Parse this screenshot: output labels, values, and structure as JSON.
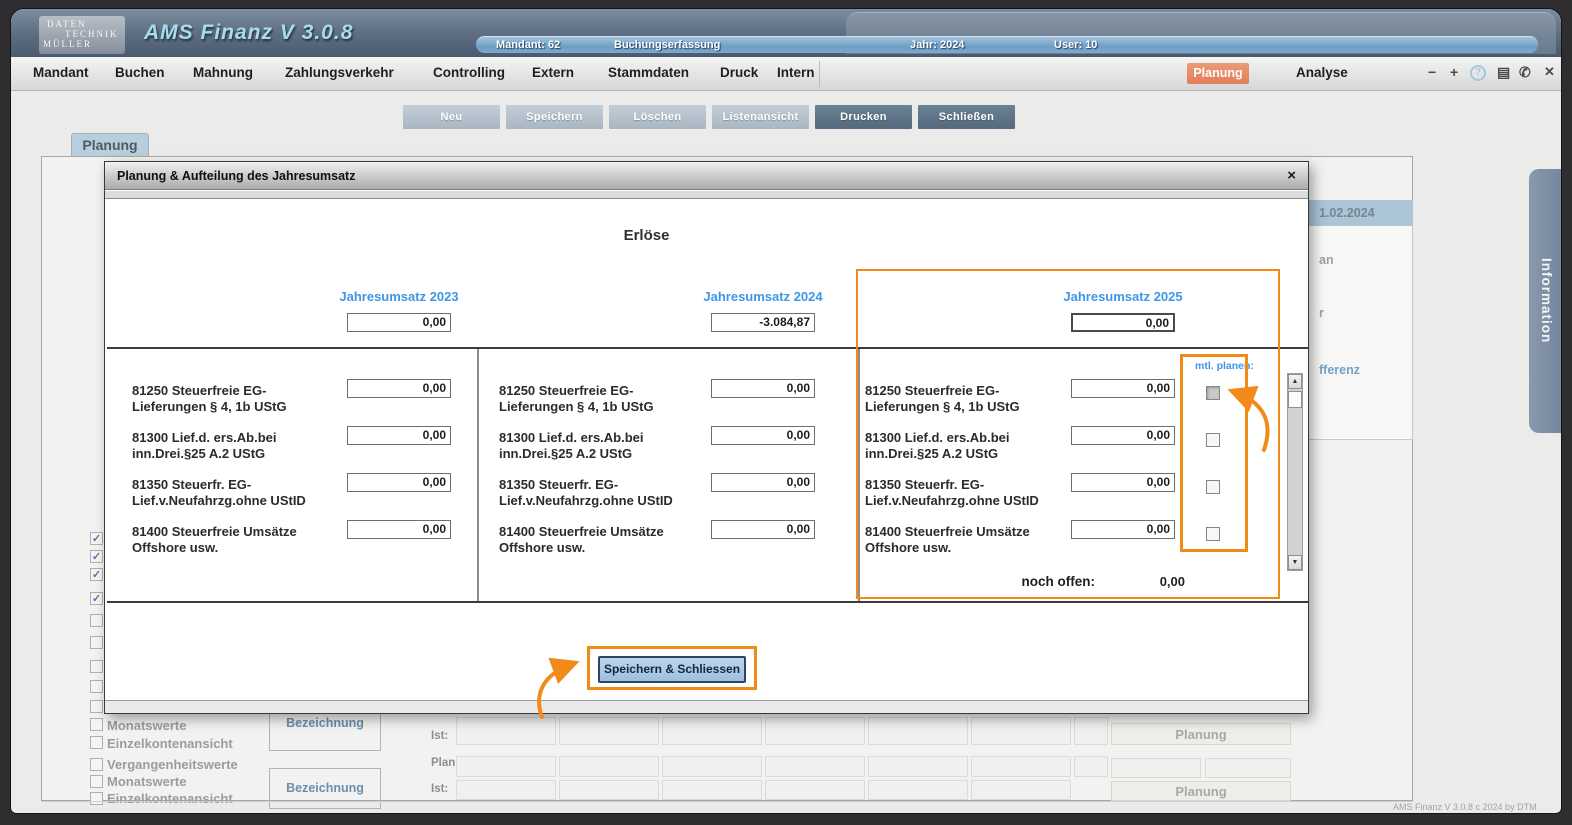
{
  "colors": {
    "accent_blue": "#3D96E8",
    "annotation_orange": "#F28A1A",
    "active_tab_salmon": "#E8876A",
    "titlebar_slate": "#5C6D81",
    "status_strip_blue": "#7FA8CC",
    "toolbar_button_light": "#B5C2CD",
    "toolbar_button_dark": "#5D7387",
    "save_button_blue": "#A9C8E6",
    "info_tab_slate": "#7D8FA5"
  },
  "titlebar": {
    "logo_lines": [
      "DATEN",
      "TECHNIK",
      "MÜLLER"
    ],
    "app_title": "AMS Finanz V 3.0.8",
    "status_items": [
      {
        "label": "Mandant: 62"
      },
      {
        "label": "Buchungserfassung"
      },
      {
        "label": "Jahr: 2024"
      },
      {
        "label": "User: 10"
      }
    ]
  },
  "menubar": {
    "items": [
      "Mandant",
      "Buchen",
      "Mahnung",
      "Zahlungsverkehr",
      "Controlling",
      "Extern",
      "Stammdaten",
      "Druck",
      "Intern"
    ],
    "right_tabs": [
      {
        "label": "Planung",
        "active": true
      },
      {
        "label": "Analyse",
        "active": false
      }
    ],
    "window_icons": [
      {
        "name": "minus",
        "glyph": "−"
      },
      {
        "name": "plus",
        "glyph": "+"
      },
      {
        "name": "help",
        "glyph": "?"
      },
      {
        "name": "notes",
        "glyph": "▤"
      },
      {
        "name": "phone",
        "glyph": "✆"
      },
      {
        "name": "close",
        "glyph": "✕"
      }
    ]
  },
  "toolbar": {
    "buttons": [
      {
        "label": "Neu",
        "variant": "light"
      },
      {
        "label": "Speichern",
        "variant": "light"
      },
      {
        "label": "Löschen",
        "variant": "light"
      },
      {
        "label": "Listenansicht",
        "variant": "light"
      },
      {
        "label": "Drucken",
        "variant": "dark"
      },
      {
        "label": "Schließen",
        "variant": "dark"
      }
    ]
  },
  "page_tab": {
    "label": "Planung"
  },
  "modal": {
    "title": "Planung & Aufteilung des Jahresumsatz",
    "close_glyph": "×",
    "heading": "Erlöse",
    "columns": [
      {
        "header": "Jahresumsatz 2023",
        "total": "0,00",
        "row_values": [
          "0,00",
          "0,00",
          "0,00",
          "0,00"
        ]
      },
      {
        "header": "Jahresumsatz 2024",
        "total": "-3.084,87",
        "row_values": [
          "0,00",
          "0,00",
          "0,00",
          "0,00"
        ]
      },
      {
        "header": "Jahresumsatz 2025",
        "total": "0,00",
        "row_values": [
          "0,00",
          "0,00",
          "0,00",
          "0,00"
        ]
      }
    ],
    "rows": [
      {
        "line1": "81250  Steuerfreie EG-",
        "line2": "Lieferungen § 4, 1b UStG"
      },
      {
        "line1": "81300  Lief.d. ers.Ab.bei",
        "line2": "inn.Drei.§25 A.2 UStG"
      },
      {
        "line1": "81350  Steuerfr. EG-",
        "line2": "Lief.v.Neufahrzg.ohne UStID"
      },
      {
        "line1": "81400  Steuerfreie Umsätze",
        "line2": "Offshore usw."
      }
    ],
    "mtl_planen_label": "mtl. planen:",
    "checkbox_states": [
      false,
      false,
      false,
      false
    ],
    "noch_offen": {
      "label": "noch offen:",
      "value": "0,00"
    },
    "save_button_label": "Speichern & Schliessen",
    "scrollbar": {
      "up": "▲",
      "down": "▼"
    }
  },
  "background": {
    "right_panel": {
      "header_date": "1.02.2024",
      "fragment_1": "an",
      "fragment_2": "r",
      "fragment_3": "fferenz"
    },
    "info_tab_label": "Information",
    "group1": {
      "checkbox_labels": [
        "Monatswerte",
        "Einzelkontenansicht"
      ],
      "box_label": "Bezeichnung",
      "row_label": "Ist:"
    },
    "group2": {
      "checkbox_labels": [
        "Vergangenheitswerte",
        "Monatswerte",
        "Einzelkontenansicht"
      ],
      "box_label": "Bezeichnung",
      "row_labels": [
        "Plan:",
        "Ist:"
      ]
    },
    "planung_button_label": "Planung",
    "check_glyph": "✓",
    "footer_text": "AMS Finanz V 3.0.8 c  2024 by DTM"
  }
}
